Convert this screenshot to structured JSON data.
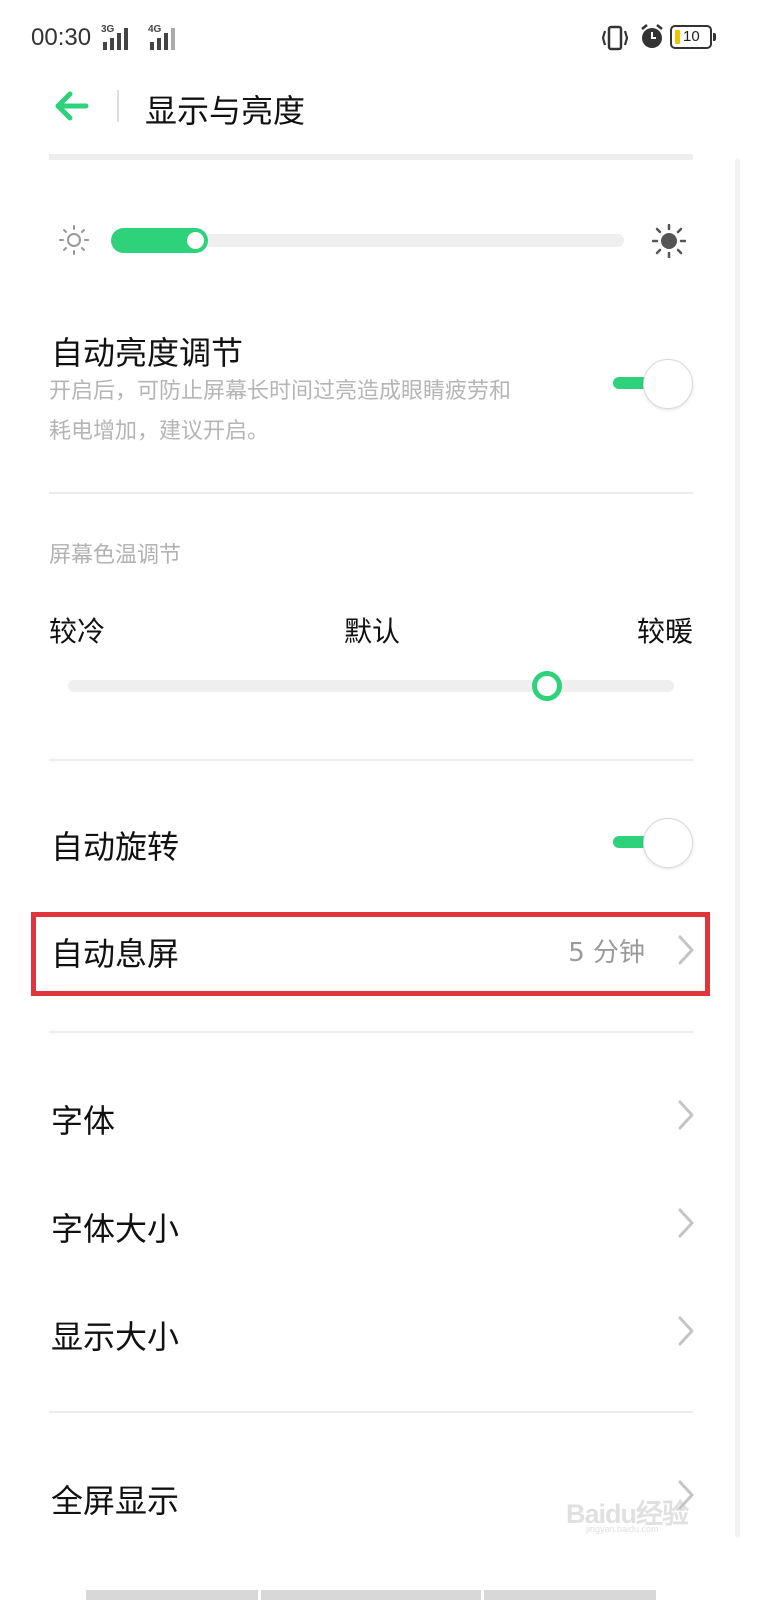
{
  "status_bar": {
    "time": "00:30",
    "network_1": "3G",
    "network_2": "4G",
    "battery_level": "10",
    "battery_color": "#f2c200"
  },
  "header": {
    "back_icon": "arrow-left-icon",
    "title": "显示与亮度",
    "accent_color": "#2dd27b"
  },
  "brightness": {
    "low_icon": "sun-outline-icon",
    "high_icon": "sun-filled-icon",
    "level_fraction": 0.19
  },
  "auto_brightness": {
    "title": "自动亮度调节",
    "description_line1": "开启后，可防止屏幕长时间过亮造成眼睛疲劳和",
    "description_line2": "耗电增加，建议开启。",
    "enabled": true
  },
  "color_temperature": {
    "section_label": "屏幕色温调节",
    "cool_label": "较冷",
    "default_label": "默认",
    "warm_label": "较暖",
    "level_fraction": 0.79
  },
  "auto_rotate": {
    "title": "自动旋转",
    "enabled": true
  },
  "auto_screen_off": {
    "title": "自动息屏",
    "value": "5 分钟",
    "highlight_color": "#e1343b"
  },
  "font_items": [
    {
      "label": "字体"
    },
    {
      "label": "字体大小"
    },
    {
      "label": "显示大小"
    }
  ],
  "fullscreen": {
    "title": "全屏显示"
  },
  "watermark": {
    "text": "Baidu经验",
    "sub": "jingyan.baidu.com"
  }
}
